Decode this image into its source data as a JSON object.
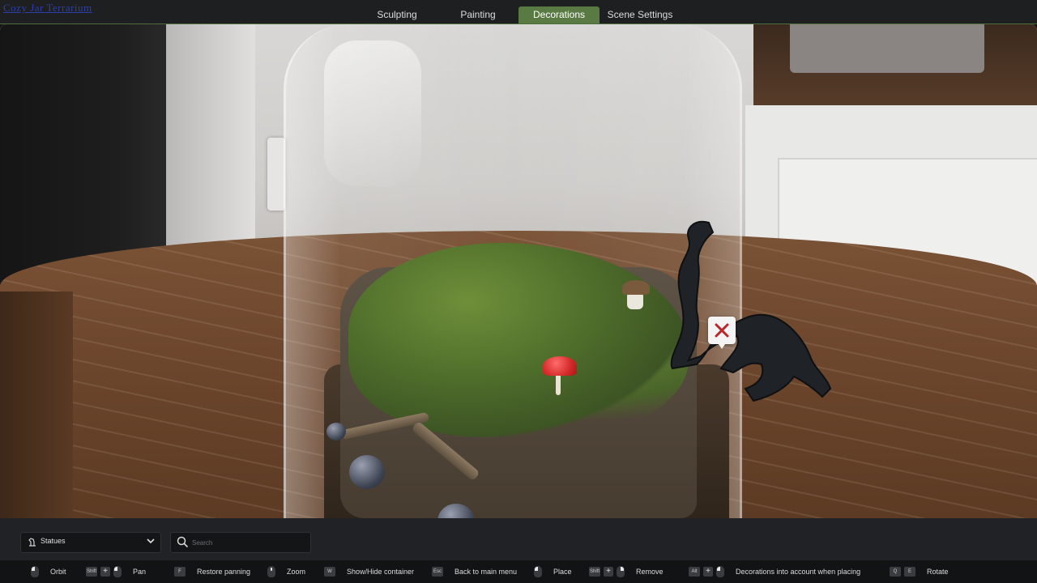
{
  "app": {
    "corner_logo": "Cozy Jar Terrarium"
  },
  "tabs": [
    {
      "label": "Sculpting",
      "active": false
    },
    {
      "label": "Painting",
      "active": false
    },
    {
      "label": "Decorations",
      "active": true
    },
    {
      "label": "Scene Settings",
      "active": false
    }
  ],
  "colors": {
    "accent": "#5a7a43",
    "panel": "#202225",
    "hintbar": "#121314"
  },
  "viewport": {
    "delete_marker_icon": "close-icon"
  },
  "category_select": {
    "value": "Statues",
    "icon": "statue-icon"
  },
  "search": {
    "placeholder": "Search",
    "value": ""
  },
  "hints": [
    {
      "keys": [
        "mouse-left"
      ],
      "label": "Orbit"
    },
    {
      "keys": [
        "Shift",
        "+",
        "mouse-left"
      ],
      "label": "Pan"
    },
    {
      "keys": [
        "F"
      ],
      "label": "Restore panning"
    },
    {
      "keys": [
        "mouse-wheel"
      ],
      "label": "Zoom"
    },
    {
      "keys": [
        "W"
      ],
      "label": "Show/Hide container"
    },
    {
      "keys": [
        "Esc"
      ],
      "label": "Back to main menu"
    },
    {
      "keys": [
        "mouse-left"
      ],
      "label": "Place"
    },
    {
      "keys": [
        "Shift",
        "+",
        "mouse-right"
      ],
      "label": "Remove"
    },
    {
      "keys": [
        "Alt",
        "+",
        "mouse-left"
      ],
      "label": "Decorations into account when placing"
    },
    {
      "keys": [
        "Q",
        "E"
      ],
      "label": "Rotate"
    }
  ]
}
